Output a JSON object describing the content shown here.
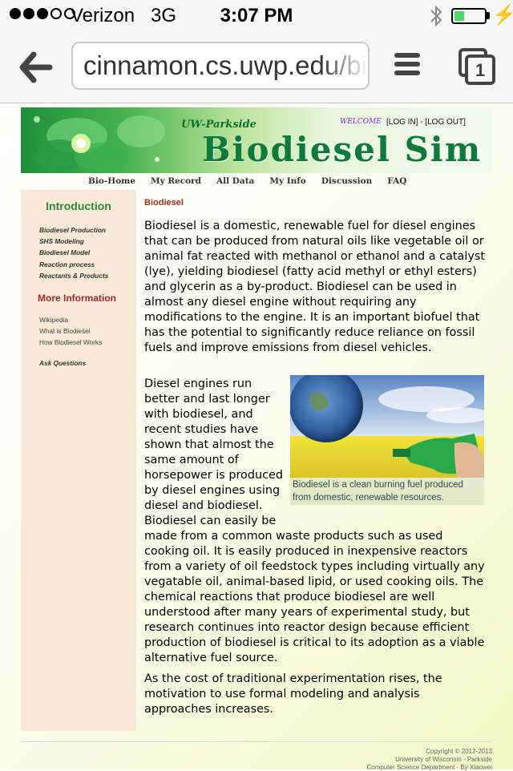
{
  "status_bar": {
    "carrier": "Verizon",
    "network": "3G",
    "time": "3:07 PM"
  },
  "browser": {
    "url": "cinnamon.cs.uwp.edu/bi",
    "tab_count": "1"
  },
  "banner": {
    "subtitle": "UW-Parkside",
    "title": "Biodiesel Sim",
    "welcome": "WELCOME",
    "login_links": "[LOG IN] - [LOG OUT]"
  },
  "nav": {
    "items": [
      "Bio-Home",
      "My Record",
      "All Data",
      "My Info",
      "Discussion",
      "FAQ"
    ]
  },
  "sidebar": {
    "heading": "Introduction",
    "intro_links": [
      "Biodiesel Production",
      "SHS Modeling",
      "Biodiesel Model",
      "Reaction process",
      "Reactants & Products"
    ],
    "more_heading": "More Information",
    "more_links": [
      "Wikipedia",
      "What is Biodiesel",
      "How Biodiesel Works"
    ],
    "ask_link": "Ask Questions"
  },
  "content": {
    "heading": "Biodiesel",
    "paragraph1": "Biodiesel is a domestic, renewable fuel for diesel engines that can be produced from natural oils like vegetable oil or animal fat reacted with methanol or ethanol and a catalyst (lye), yielding biodiesel (fatty acid methyl or ethyl esters) and glycerin as a by-product. Biodiesel can be used in almost any diesel engine without requiring any modifications to the engine. It is an important biofuel that has the potential to significantly reduce reliance on fossil fuels and improve emissions from diesel vehicles.",
    "paragraph2": "Diesel engines run better and last longer with biodiesel, and recent studies have shown that almost the same amount of horsepower is produced by diesel engines using diesel and biodiesel. Biodiesel can easily be made from a common waste products such as used cooking oil. It is easily produced in inexpensive reactors from a variety of oil feedstock types including virtually any vegatable oil, animal-based lipid, or used cooking oils. The chemical reactions that produce biodiesel are well understood after many years of experimental study, but research continues into reactor design because efficient production of biodiesel is critical to its adoption as a viable alternative fuel source.",
    "paragraph3": "As the cost of traditional experimentation rises, the motivation to use formal modeling and analysis approaches increases.",
    "figure_caption": "Biodiesel is a clean burning fuel produced from domestic, renewable resources."
  },
  "footer": {
    "copyright": "Copyright © 2012-2013",
    "university": "University of Wisconsin - Parkside",
    "department": "Computer Science Department  ·  By Xiaowei"
  },
  "colors": {
    "banner_green": "#0d7a3c",
    "sidebar_bg": "#f8ead6",
    "heading_red": "#a03020",
    "intro_green": "#2a8b3d"
  },
  "icons": [
    "back-arrow-icon",
    "menu-icon",
    "tabs-icon",
    "bluetooth-icon",
    "battery-icon",
    "charging-icon"
  ]
}
